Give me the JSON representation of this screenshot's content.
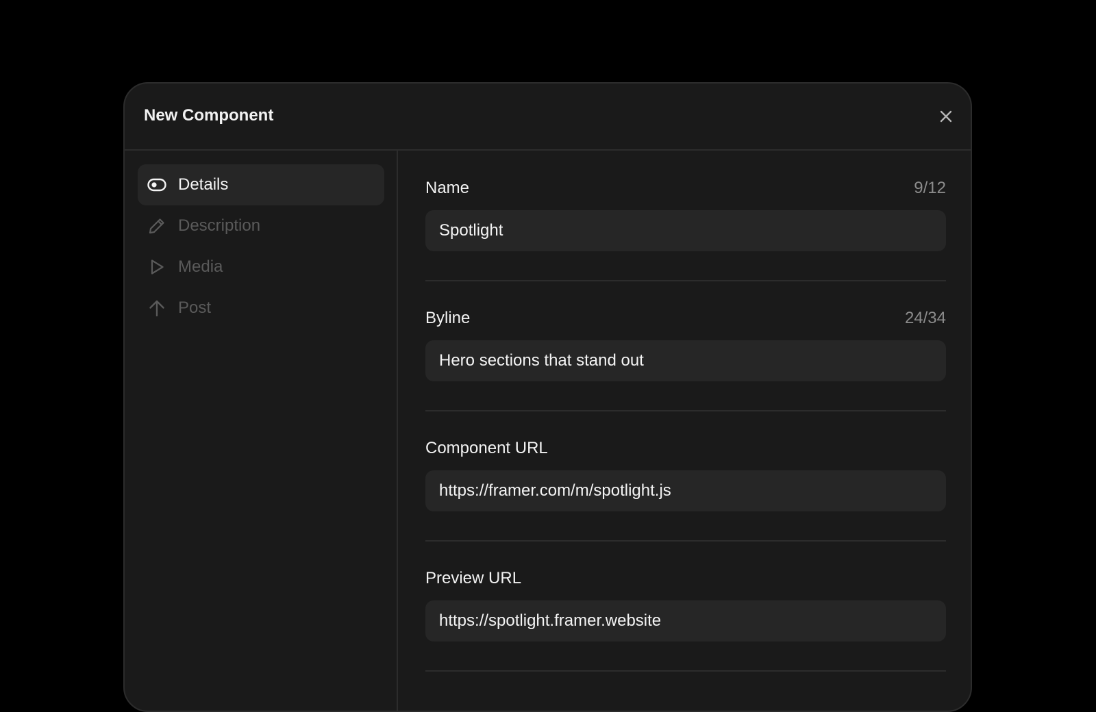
{
  "modal": {
    "title": "New Component",
    "close_icon": "close-icon"
  },
  "sidebar": {
    "items": [
      {
        "label": "Details",
        "icon": "toggle-icon",
        "active": true
      },
      {
        "label": "Description",
        "icon": "pencil-icon",
        "active": false
      },
      {
        "label": "Media",
        "icon": "play-icon",
        "active": false
      },
      {
        "label": "Post",
        "icon": "arrow-up-icon",
        "active": false
      }
    ]
  },
  "form": {
    "fields": [
      {
        "label": "Name",
        "count": "9/12",
        "value": "Spotlight"
      },
      {
        "label": "Byline",
        "count": "24/34",
        "value": "Hero sections that stand out"
      },
      {
        "label": "Component URL",
        "value": "https://framer.com/m/spotlight.js"
      },
      {
        "label": "Preview URL",
        "value": "https://spotlight.framer.website"
      }
    ]
  },
  "colors": {
    "background": "#000000",
    "modal": "#1a1a1a",
    "input": "#262626",
    "divider": "#2c2c2c",
    "text_primary": "#f2f2f2",
    "text_muted": "#5a5a5a",
    "counter": "#8c8c8c"
  }
}
